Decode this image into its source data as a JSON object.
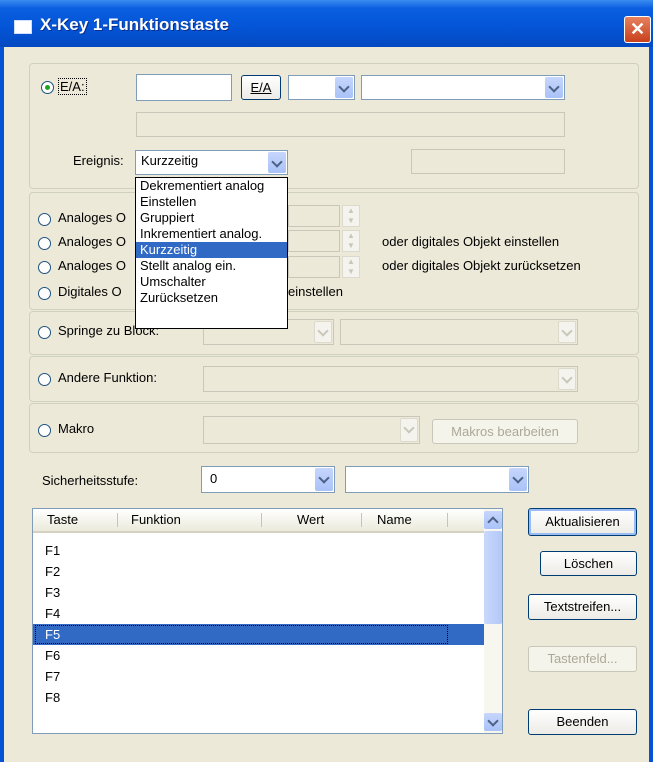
{
  "window": {
    "title": "X-Key 1-Funktionstaste",
    "close": "✕"
  },
  "ea": {
    "radio_label": "E/A:",
    "button_label": "E/A",
    "event_label": "Ereignis:",
    "event_value": "Kurzzeitig",
    "dropdown_options": [
      "Dekrementiert analog",
      "Einstellen",
      "Gruppiert",
      "Inkrementiert analog.",
      "Kurzzeitig",
      "Stellt analog ein.",
      "Umschalter",
      "Zurücksetzen"
    ],
    "dropdown_selected": "Kurzzeitig"
  },
  "analog": {
    "options": [
      "Analoges O",
      "Analoges O",
      "Analoges O",
      "Digitales O"
    ],
    "notes": [
      "oder digitales Objekt einstellen",
      "oder digitales Objekt zurücksetzen"
    ],
    "digital_suffix": "einstellen"
  },
  "springe": {
    "label": "Springe zu Block:"
  },
  "andere": {
    "label": "Andere Funktion:"
  },
  "makro": {
    "label": "Makro",
    "button": "Makros bearbeiten"
  },
  "security": {
    "label": "Sicherheitsstufe:",
    "value": "0"
  },
  "table": {
    "headers": [
      "Taste",
      "Funktion",
      "Wert",
      "Name"
    ],
    "rows": [
      "F1",
      "F2",
      "F3",
      "F4",
      "F5",
      "F6",
      "F7",
      "F8"
    ],
    "selected": "F5"
  },
  "buttons": {
    "refresh": "Aktualisieren",
    "delete": "Löschen",
    "textstrips": "Textstreifen...",
    "keypad": "Tastenfeld...",
    "exit": "Beenden"
  },
  "colors": {
    "title_bar": "#0454d6",
    "selection": "#316ac5",
    "dialog_bg": "#ece9d8"
  }
}
